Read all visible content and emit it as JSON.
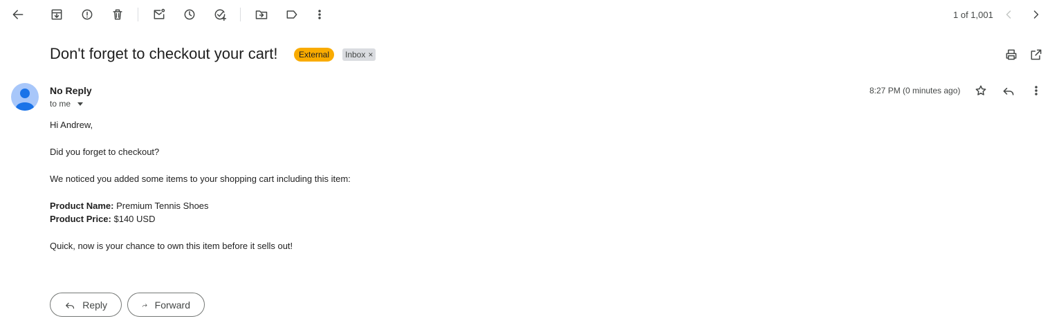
{
  "toolbar": {
    "icons": [
      "back-arrow-icon",
      "archive-icon",
      "report-spam-icon",
      "delete-icon",
      "mark-unread-icon",
      "snooze-icon",
      "add-task-icon",
      "move-to-icon",
      "label-icon",
      "more-vert-icon"
    ],
    "pager": "1 of 1,001"
  },
  "email": {
    "subject": "Don't forget to checkout your cart!",
    "labels": {
      "external": "External",
      "inbox": "Inbox",
      "remove": "×"
    },
    "sender": "No Reply",
    "to": "to me",
    "timestamp": "8:27 PM (0 minutes ago)",
    "body": {
      "greeting": "Hi Andrew,",
      "line1": "Did you forget to checkout?",
      "line2": "We noticed you added some items to your shopping cart including this item:",
      "product_name_label": "Product Name:",
      "product_name": "Premium Tennis Shoes",
      "product_price_label": "Product Price:",
      "product_price": "$140 USD",
      "closing": "Quick, now is your chance to own this item before it sells out!"
    }
  },
  "actions": {
    "reply": "Reply",
    "forward": "Forward"
  },
  "colors": {
    "external_badge": "#f9ab00",
    "inbox_badge": "#dadce0",
    "avatar_bg": "#a8c7fa",
    "avatar_fg": "#1a73e8"
  }
}
